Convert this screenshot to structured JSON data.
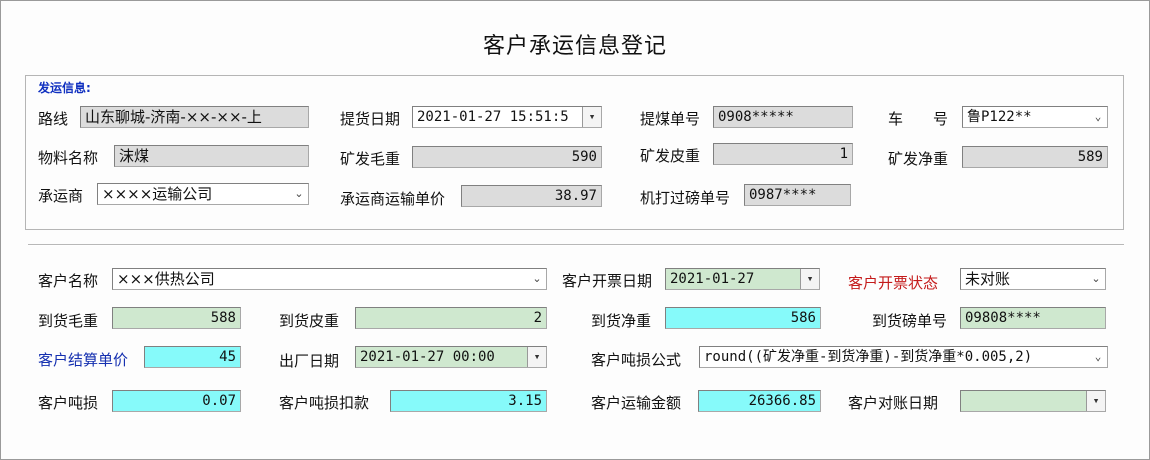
{
  "title": "客户承运信息登记",
  "shipping": {
    "group_label": "发运信息:",
    "route": {
      "label": "路线",
      "value": "山东聊城-济南-××-××-上"
    },
    "pickup_date": {
      "label": "提货日期",
      "value": "2021-01-27 15:51:5"
    },
    "coal_order_no": {
      "label": "提煤单号",
      "value": "0908*****"
    },
    "vehicle": {
      "label": "车　　号",
      "value": "鲁P122**"
    },
    "material": {
      "label": "物料名称",
      "value": "沫煤"
    },
    "mine_gross": {
      "label": "矿发毛重",
      "value": "590"
    },
    "mine_tare": {
      "label": "矿发皮重",
      "value": "1"
    },
    "mine_net": {
      "label": "矿发净重",
      "value": "589"
    },
    "carrier": {
      "label": "承运商",
      "value": "××××运输公司"
    },
    "carrier_unit_price": {
      "label": "承运商运输单价",
      "value": "38.97"
    },
    "machine_weigh_no": {
      "label": "机打过磅单号",
      "value": "0987****"
    }
  },
  "customer": {
    "name": {
      "label": "客户名称",
      "value": "×××供热公司"
    },
    "invoice_date": {
      "label": "客户开票日期",
      "value": "2021-01-27"
    },
    "invoice_status": {
      "label": "客户开票状态",
      "value": "未对账"
    },
    "arrival_gross": {
      "label": "到货毛重",
      "value": "588"
    },
    "arrival_tare": {
      "label": "到货皮重",
      "value": "2"
    },
    "arrival_net": {
      "label": "到货净重",
      "value": "586"
    },
    "arrival_weigh_no": {
      "label": "到货磅单号",
      "value": "09808****"
    },
    "settle_price": {
      "label": "客户结算单价",
      "value": "45"
    },
    "departure_date": {
      "label": "出厂日期",
      "value": "2021-01-27 00:00"
    },
    "loss_formula": {
      "label": "客户吨损公式",
      "value": "round((矿发净重-到货净重)-到货净重*0.005,2)"
    },
    "ton_loss": {
      "label": "客户吨损",
      "value": "0.07"
    },
    "loss_deduction": {
      "label": "客户吨损扣款",
      "value": "3.15"
    },
    "transport_amount": {
      "label": "客户运输金额",
      "value": "26366.85"
    },
    "reconcile_date": {
      "label": "客户对账日期",
      "value": ""
    }
  },
  "icons": {
    "dropdown": "chevron-down-icon"
  },
  "colors": {
    "readonly_gray": "#dcdcdc",
    "editable_green": "#cfe8cf",
    "highlight_cyan": "#86fafa",
    "label_blue": "#1530b0",
    "label_red": "#c41a1a"
  }
}
